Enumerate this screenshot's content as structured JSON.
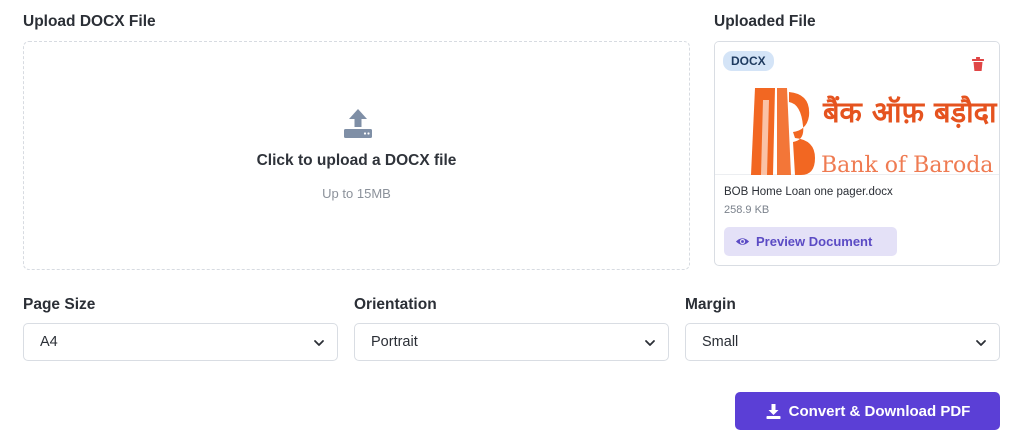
{
  "upload": {
    "title": "Upload DOCX File",
    "prompt": "Click to upload a DOCX file",
    "limit": "Up to 15MB",
    "icon": "upload-icon"
  },
  "uploaded": {
    "title": "Uploaded File",
    "badge": "DOCX",
    "file_name": "BOB Home Loan one pager.docx",
    "file_size": "258.9 KB",
    "preview_label": "Preview Document",
    "thumbnail_text": "बैंक ऑफ़ बड़ौदा",
    "thumbnail_text_en": "Bank of Baroda",
    "colors": {
      "brand_orange": "#f26722",
      "badge_bg": "#d4e4f7",
      "trash_red": "#e04646"
    }
  },
  "options": {
    "page_size": {
      "label": "Page Size",
      "value": "A4"
    },
    "orientation": {
      "label": "Orientation",
      "value": "Portrait"
    },
    "margin": {
      "label": "Margin",
      "value": "Small"
    }
  },
  "actions": {
    "convert_label": "Convert & Download PDF",
    "accent": "#5b3fd6"
  }
}
